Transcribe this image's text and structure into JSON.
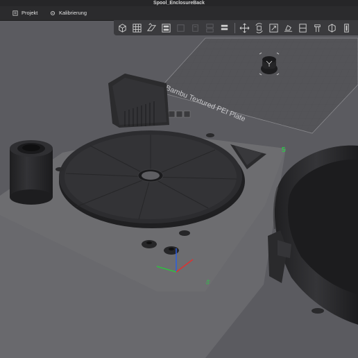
{
  "window": {
    "title": "Spool_EnclosureBack"
  },
  "menu": {
    "items": [
      {
        "label": "Projekt",
        "icon": "project-icon"
      },
      {
        "label": "Kalibrierung",
        "icon": "calibration-icon"
      }
    ]
  },
  "toolbar": {
    "left_group": [
      "add-object-icon",
      "arrange-grid-icon",
      "orient-icon",
      "layout-plate-icon"
    ],
    "middle_group": [
      "disabled-icon-1",
      "disabled-icon-2",
      "split-icon",
      "layers-icon"
    ],
    "right_group": [
      "move-icon",
      "rotate-icon",
      "scale-icon",
      "lay-on-face-icon",
      "cut-icon",
      "support-paint-icon",
      "seam-paint-icon",
      "color-paint-icon",
      "measure-icon"
    ]
  },
  "plate": {
    "label": "Bambu Textured PEI Plate",
    "plate_number": "5"
  },
  "colors": {
    "background": "#5b5b60",
    "menubar": "#2b2b2d",
    "toolbar": "#3a3a3d",
    "plate": "#6c6c70",
    "pei_plate": "#57575b",
    "model": "#2a2a2c"
  }
}
